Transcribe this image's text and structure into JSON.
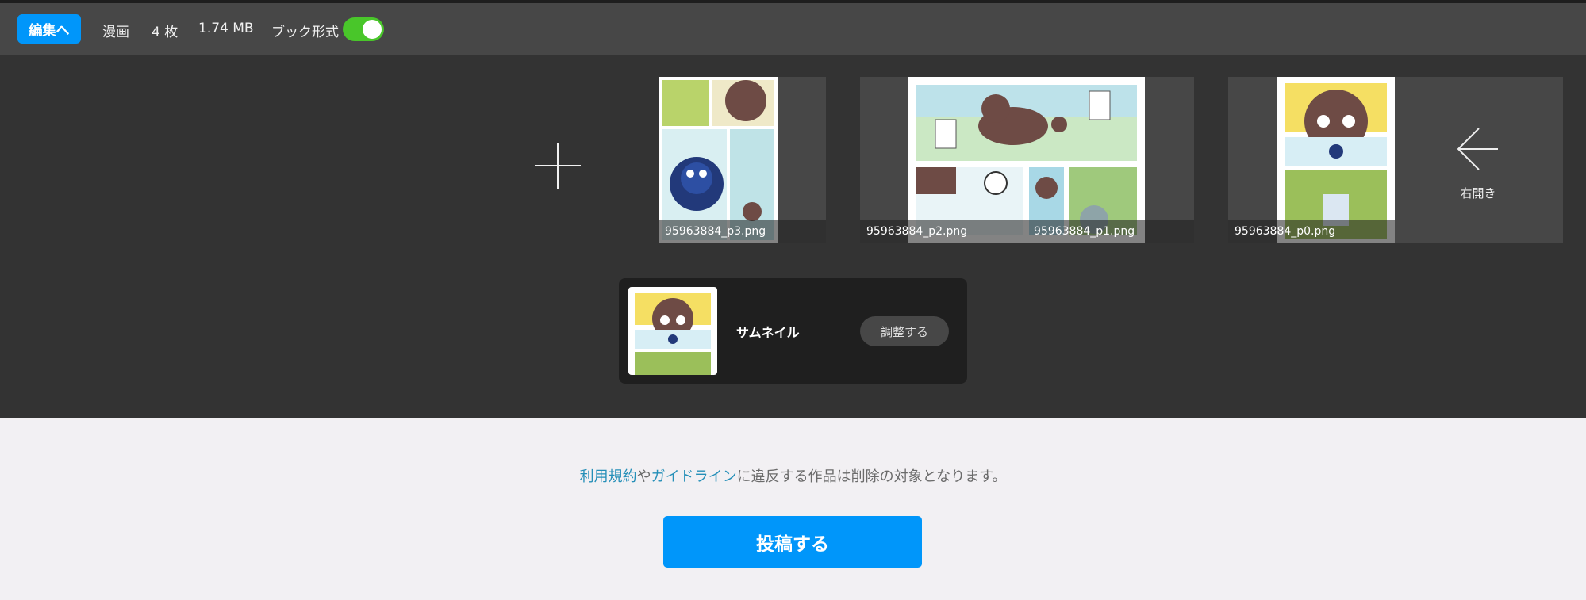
{
  "toolbar": {
    "edit_label": "編集へ",
    "type": "漫画",
    "count": "4 枚",
    "size": "1.74 MB",
    "book_format_label": "ブック形式",
    "book_format_on": true
  },
  "pages": [
    {
      "filename": "95963884_p3.png"
    },
    {
      "filename": "95963884_p2.png"
    },
    {
      "filename": "95963884_p1.png"
    },
    {
      "filename": "95963884_p0.png"
    }
  ],
  "direction": {
    "icon": "arrow-left-icon",
    "label": "右開き"
  },
  "thumbnail": {
    "label": "サムネイル",
    "adjust_label": "調整する"
  },
  "footer": {
    "terms_link": "利用規約",
    "connector": "や",
    "guideline_link": "ガイドライン",
    "notice_rest": "に違反する作品は削除の対象となります。",
    "submit_label": "投稿する"
  },
  "colors": {
    "accent": "#0096fa",
    "toggle_on": "#49c62a",
    "link": "#258fb8",
    "editor_bg": "#333333",
    "topbar_bg": "#474747"
  }
}
